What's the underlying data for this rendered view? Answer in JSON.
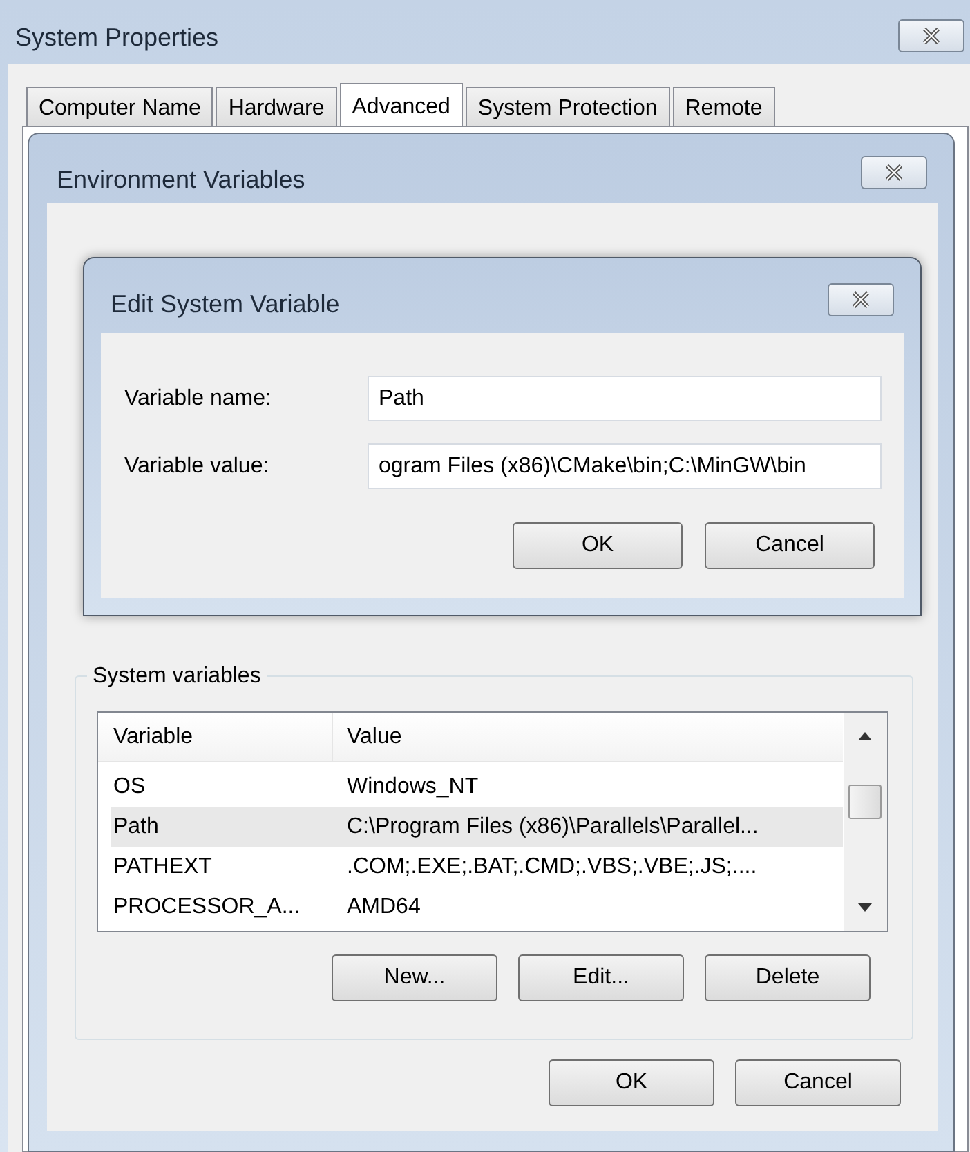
{
  "system_properties": {
    "title": "System Properties",
    "tabs": [
      {
        "label": "Computer Name",
        "selected": false
      },
      {
        "label": "Hardware",
        "selected": false
      },
      {
        "label": "Advanced",
        "selected": true
      },
      {
        "label": "System Protection",
        "selected": false
      },
      {
        "label": "Remote",
        "selected": false
      }
    ]
  },
  "environment_variables": {
    "title": "Environment Variables",
    "system_variables": {
      "legend": "System variables",
      "columns": [
        "Variable",
        "Value"
      ],
      "rows": [
        {
          "variable": "OS",
          "value": "Windows_NT",
          "selected": false
        },
        {
          "variable": "Path",
          "value": "C:\\Program Files (x86)\\Parallels\\Parallel...",
          "selected": true
        },
        {
          "variable": "PATHEXT",
          "value": ".COM;.EXE;.BAT;.CMD;.VBS;.VBE;.JS;....",
          "selected": false
        },
        {
          "variable": "PROCESSOR_A...",
          "value": "AMD64",
          "selected": false
        }
      ],
      "buttons": [
        "New...",
        "Edit...",
        "Delete"
      ]
    },
    "buttons": [
      "OK",
      "Cancel"
    ]
  },
  "edit_dialog": {
    "title": "Edit System Variable",
    "fields": [
      {
        "label": "Variable name:",
        "value": "Path"
      },
      {
        "label": "Variable value:",
        "value": "ogram Files (x86)\\CMake\\bin;C:\\MinGW\\bin"
      }
    ],
    "buttons": [
      "OK",
      "Cancel"
    ]
  }
}
